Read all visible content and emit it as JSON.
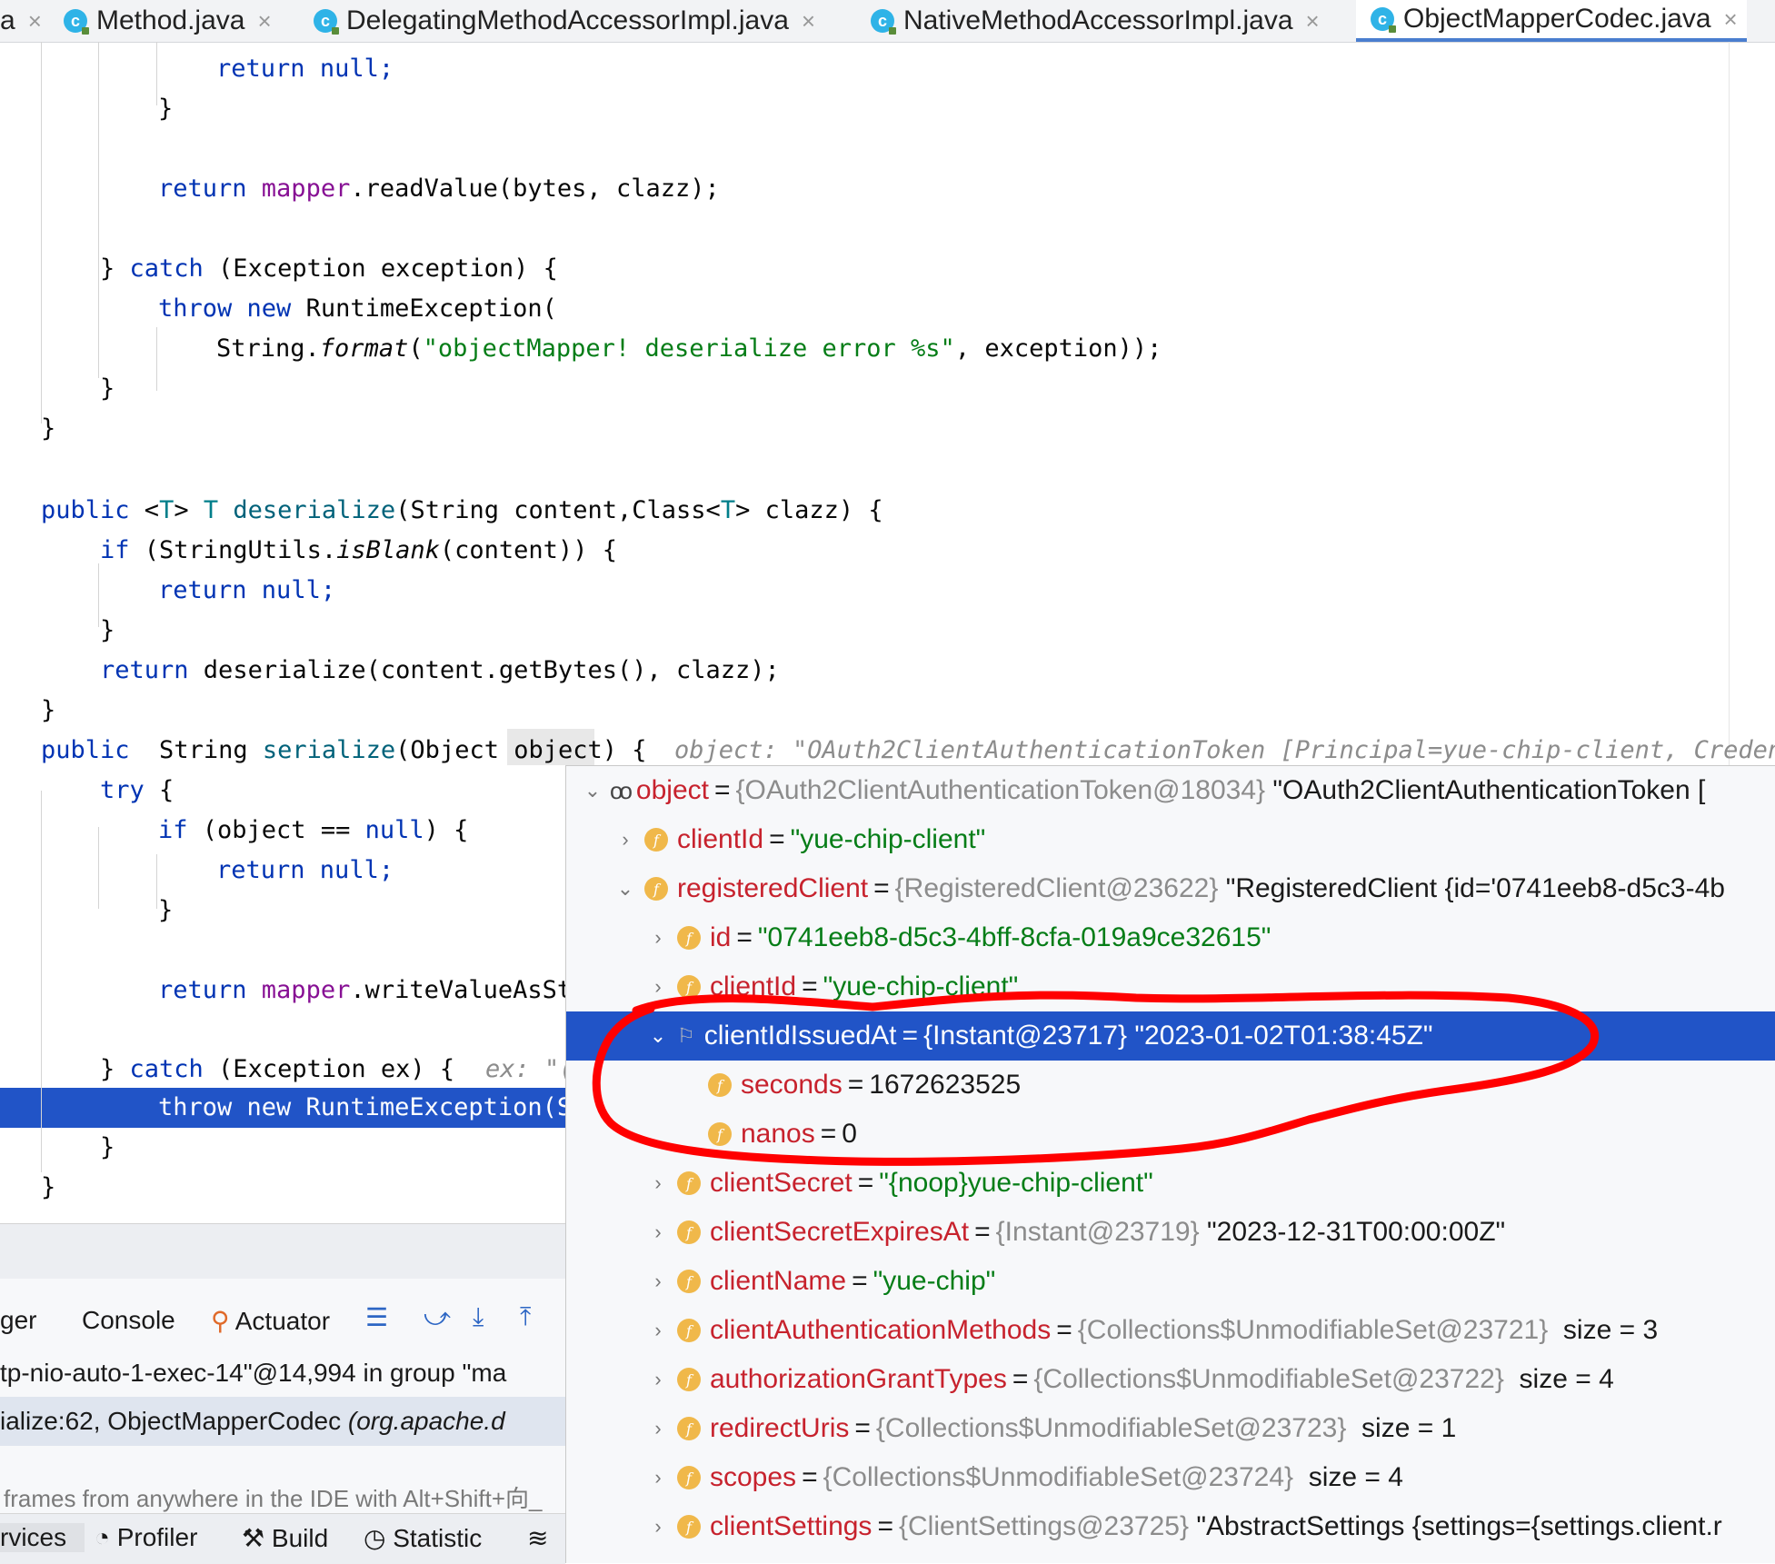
{
  "tabs": [
    {
      "label": "Method.java",
      "active": false
    },
    {
      "label": "DelegatingMethodAccessorImpl.java",
      "active": false
    },
    {
      "label": "NativeMethodAccessorImpl.java",
      "active": false
    },
    {
      "label": "ObjectMapperCodec.java",
      "active": true
    }
  ],
  "tab_partial": "a",
  "code": {
    "l1": [
      "return",
      "null;"
    ],
    "l2": "}",
    "l3": [
      "return ",
      "mapper",
      ".readValue(bytes, clazz);"
    ],
    "l4": [
      "} ",
      "catch",
      " (Exception exception) {"
    ],
    "l5": [
      "throw new",
      " RuntimeException("
    ],
    "l6": [
      "String.",
      "format",
      "(",
      "\"objectMapper! deserialize error %s\"",
      ", exception));"
    ],
    "l7": "}",
    "l8": "}",
    "l9": [
      "public",
      " <",
      "T",
      "> ",
      "T",
      " ",
      "deserialize",
      "(String content,Class<",
      "T",
      "> clazz) {"
    ],
    "l10": [
      "if",
      " (StringUtils.",
      "isBlank",
      "(content)) {"
    ],
    "l11": [
      "return",
      " null;"
    ],
    "l12": "}",
    "l13": [
      "return",
      " deserialize(content.getBytes(), clazz);"
    ],
    "l14": "}",
    "l15": [
      "public",
      "  String ",
      "serialize",
      "(Object ",
      "object",
      ") {"
    ],
    "l15_hint": "object: \"OAuth2ClientAuthenticationToken [Principal=yue-chip-client, Credent",
    "l16": [
      "try",
      " {"
    ],
    "l17": [
      "if",
      " (object == ",
      "null",
      ") {"
    ],
    "l18": [
      "return",
      " null;"
    ],
    "l19": "}",
    "l20": [
      "return ",
      "mapper",
      ".writeValueAsSt"
    ],
    "l21": [
      "} ",
      "catch",
      " (Exception ex) {"
    ],
    "l21_hint": "ex: \"(",
    "l22": "throw new RuntimeException(S",
    "l23": "}",
    "l24": "}"
  },
  "debug_panel": {
    "tabs": [
      "ger",
      "Console",
      "Actuator"
    ],
    "thread": "tp-nio-auto-1-exec-14\"@14,994 in group \"ma",
    "frame_method": "ialize:62, ObjectMapperCodec ",
    "frame_pkg": "(org.apache.d",
    "hint": "frames from anywhere in the IDE with Alt+Shift+向_",
    "bottom_tools": [
      "rvices",
      "Profiler",
      "Build",
      "Statistic"
    ]
  },
  "variables": {
    "root": {
      "name": "object",
      "ref": "{OAuth2ClientAuthenticationToken@18034}",
      "value": "\"OAuth2ClientAuthenticationToken ["
    },
    "clientId": {
      "name": "clientId",
      "value": "\"yue-chip-client\""
    },
    "registeredClient": {
      "name": "registeredClient",
      "ref": "{RegisteredClient@23622}",
      "value": "\"RegisteredClient {id='0741eeb8-d5c3-4b"
    },
    "id": {
      "name": "id",
      "value": "\"0741eeb8-d5c3-4bff-8cfa-019a9ce32615\""
    },
    "clientId2": {
      "name": "clientId",
      "value": "\"yue-chip-client\""
    },
    "clientIdIssuedAt": {
      "name": "clientIdIssuedAt",
      "ref": "{Instant@23717}",
      "value": "\"2023-01-02T01:38:45Z\""
    },
    "seconds": {
      "name": "seconds",
      "value": "1672623525"
    },
    "nanos": {
      "name": "nanos",
      "value": "0"
    },
    "clientSecret": {
      "name": "clientSecret",
      "value": "\"{noop}yue-chip-client\""
    },
    "clientSecretExpiresAt": {
      "name": "clientSecretExpiresAt",
      "ref": "{Instant@23719}",
      "value": "\"2023-12-31T00:00:00Z\""
    },
    "clientName": {
      "name": "clientName",
      "value": "\"yue-chip\""
    },
    "clientAuthenticationMethods": {
      "name": "clientAuthenticationMethods",
      "ref": "{Collections$UnmodifiableSet@23721}",
      "value": "size = 3"
    },
    "authorizationGrantTypes": {
      "name": "authorizationGrantTypes",
      "ref": "{Collections$UnmodifiableSet@23722}",
      "value": "size = 4"
    },
    "redirectUris": {
      "name": "redirectUris",
      "ref": "{Collections$UnmodifiableSet@23723}",
      "value": "size = 1"
    },
    "scopes": {
      "name": "scopes",
      "ref": "{Collections$UnmodifiableSet@23724}",
      "value": "size = 4"
    },
    "clientSettings": {
      "name": "clientSettings",
      "ref": "{ClientSettings@23725}",
      "value": "\"AbstractSettings {settings={settings.client.r"
    }
  },
  "colors": {
    "selection": "#2154c7",
    "annotation": "#ff0000",
    "field_icon": "#f0b84a",
    "class_icon": "#2fb3e7"
  }
}
